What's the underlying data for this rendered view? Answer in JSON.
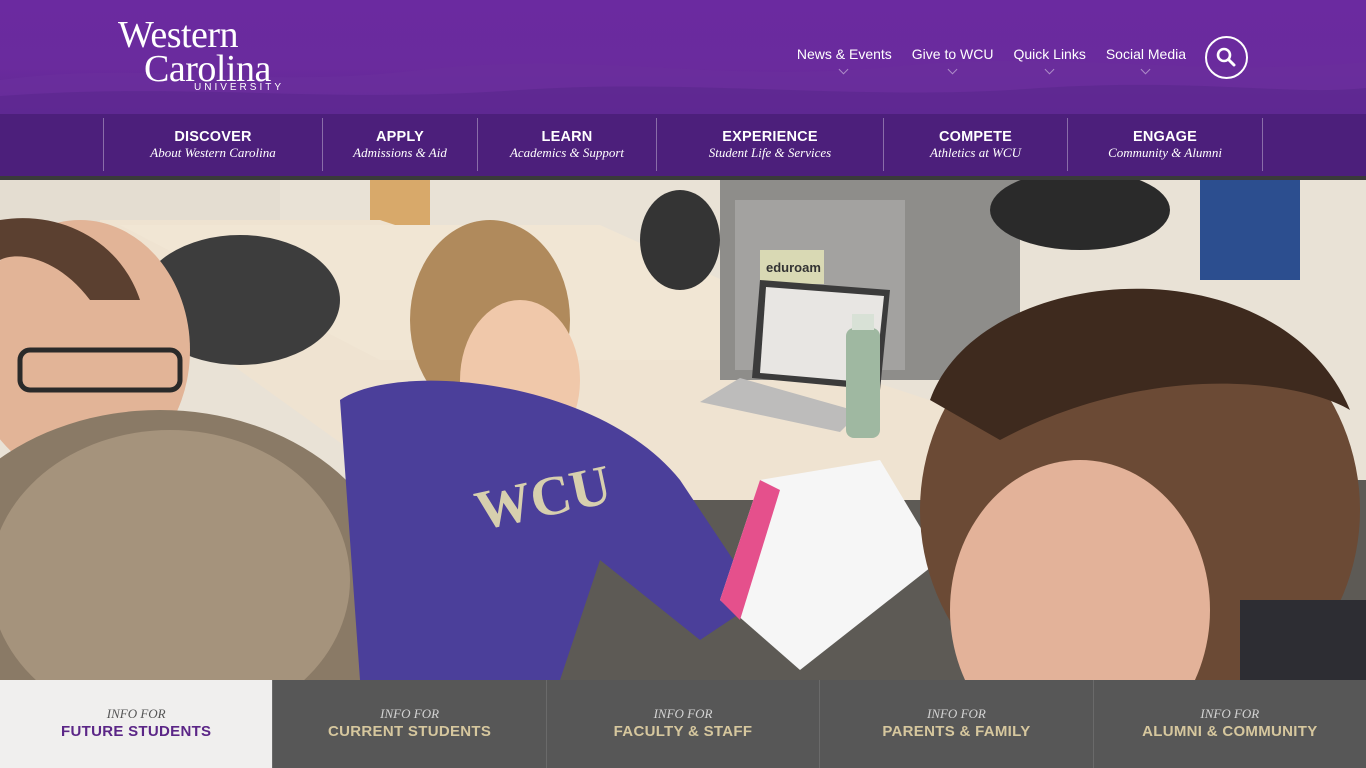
{
  "logo": {
    "line1": "Western",
    "line2": "Carolina",
    "line3": "UNIVERSITY"
  },
  "utility_nav": [
    {
      "label": "News & Events"
    },
    {
      "label": "Give to WCU"
    },
    {
      "label": "Quick Links"
    },
    {
      "label": "Social Media"
    }
  ],
  "main_nav": [
    {
      "title": "DISCOVER",
      "subtitle": "About Western Carolina"
    },
    {
      "title": "APPLY",
      "subtitle": "Admissions & Aid"
    },
    {
      "title": "LEARN",
      "subtitle": "Academics & Support"
    },
    {
      "title": "EXPERIENCE",
      "subtitle": "Student Life & Services"
    },
    {
      "title": "COMPETE",
      "subtitle": "Athletics at WCU"
    },
    {
      "title": "ENGAGE",
      "subtitle": "Community & Alumni"
    }
  ],
  "audience_tabs": [
    {
      "prefix": "INFO FOR",
      "label": "FUTURE STUDENTS",
      "active": true
    },
    {
      "prefix": "INFO FOR",
      "label": "CURRENT STUDENTS",
      "active": false
    },
    {
      "prefix": "INFO FOR",
      "label": "FACULTY & STAFF",
      "active": false
    },
    {
      "prefix": "INFO FOR",
      "label": "PARENTS & FAMILY",
      "active": false
    },
    {
      "prefix": "INFO FOR",
      "label": "ALUMNI & COMMUNITY",
      "active": false
    }
  ],
  "hero": {
    "hoodie_text": "WCU",
    "sign_text": "eduroam"
  },
  "colors": {
    "brand_purple": "#6b2aa0",
    "nav_purple": "#4c1f7b",
    "gold": "#d6c79e",
    "bar_gray": "#575757"
  }
}
